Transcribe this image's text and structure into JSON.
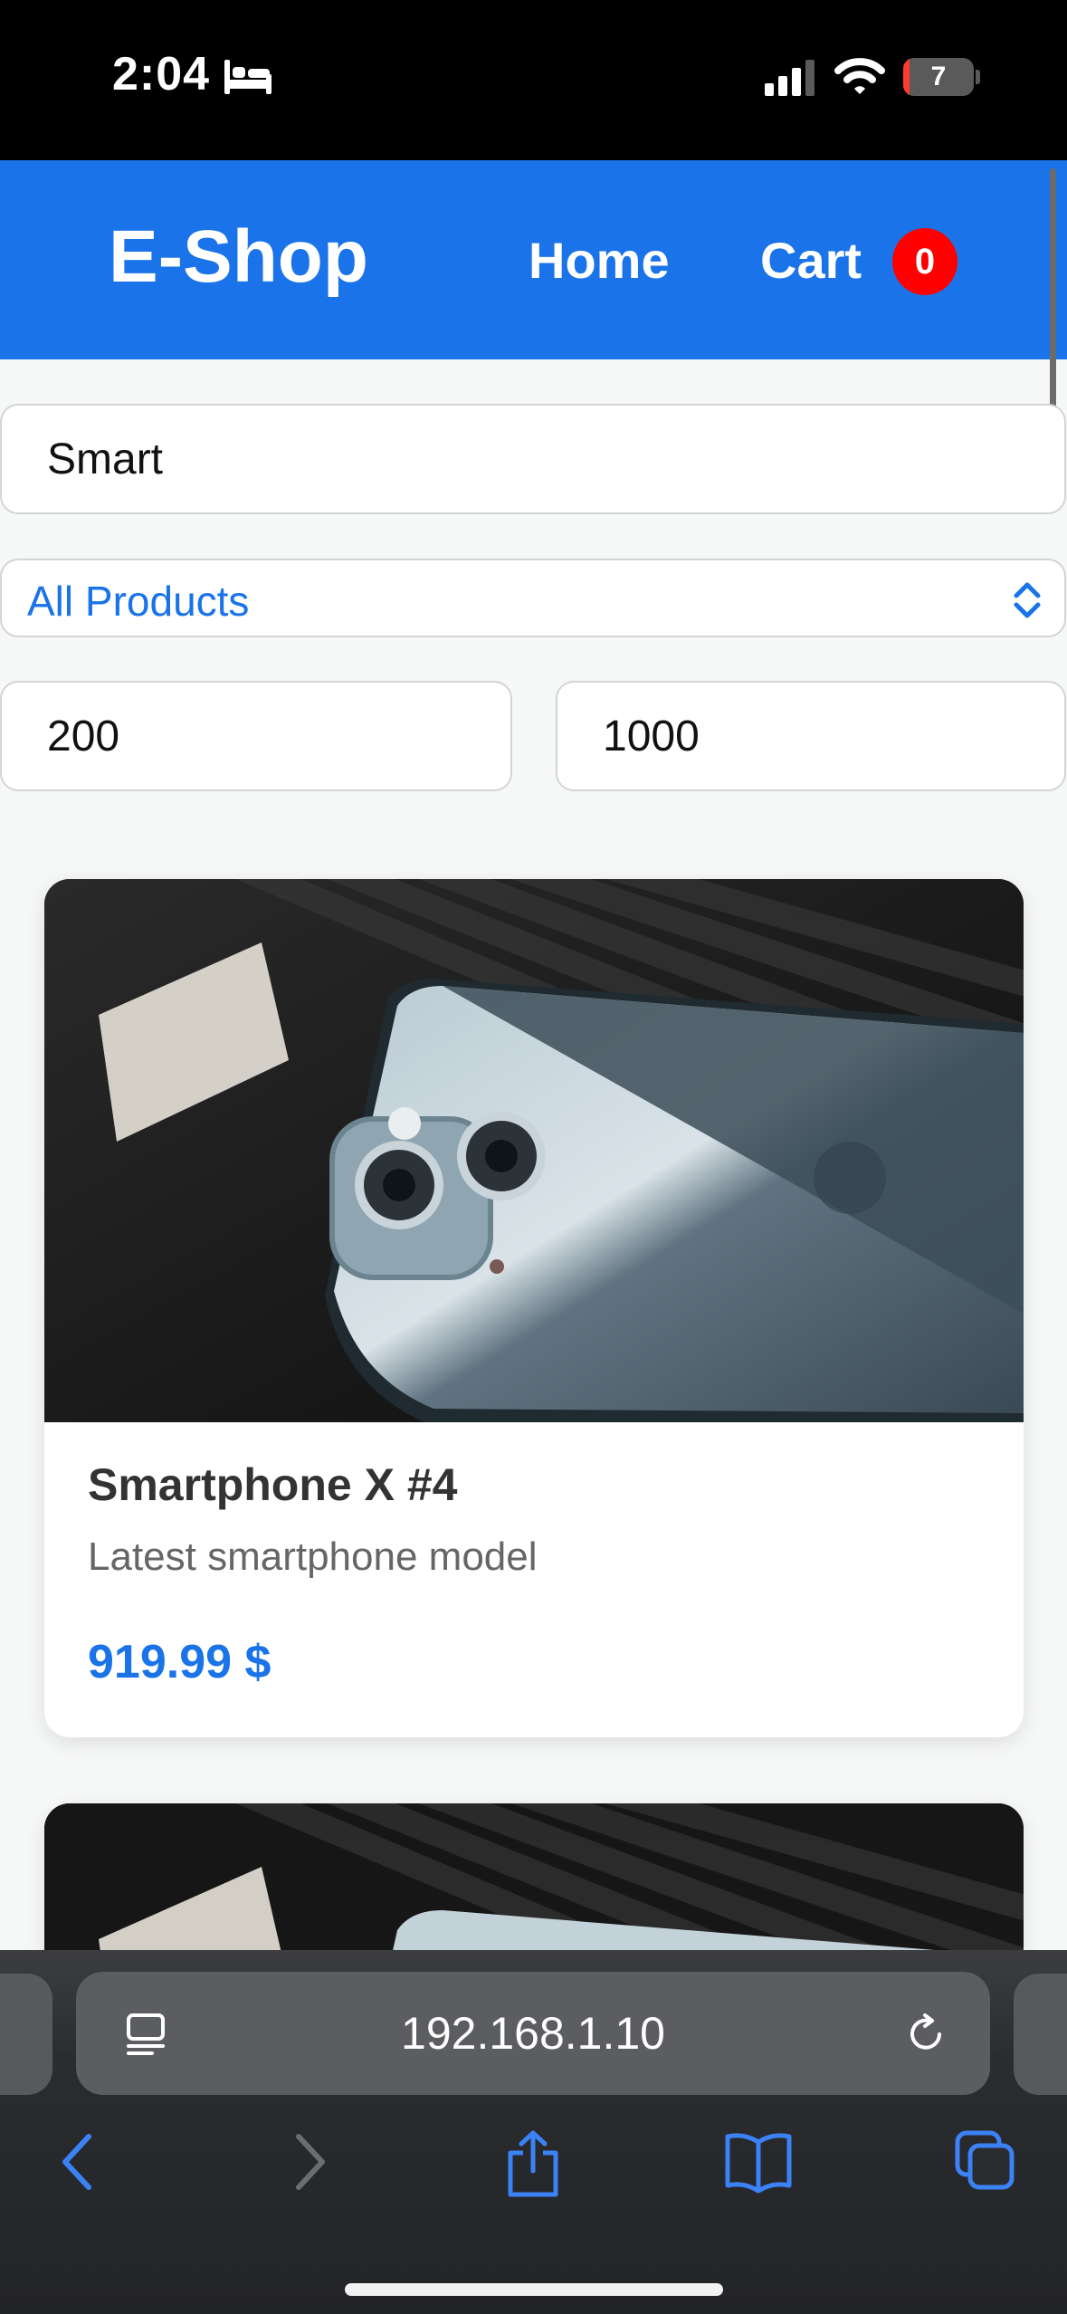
{
  "status_bar": {
    "time": "2:04",
    "battery": "7",
    "icons": [
      "bed-icon",
      "cellular-signal-icon",
      "wifi-icon",
      "battery-icon"
    ]
  },
  "header": {
    "logo": "E-Shop",
    "nav": {
      "home": "Home",
      "cart": "Cart"
    },
    "cart_count": "0"
  },
  "filters": {
    "search_value": "Smart",
    "category_selected": "All Products",
    "min_price": "200",
    "max_price": "1000"
  },
  "products": [
    {
      "title": "Smartphone X #4",
      "description": "Latest smartphone model",
      "price": "919.99 $"
    }
  ],
  "browser": {
    "url": "192.168.1.10",
    "icons": [
      "reader-icon",
      "reload-icon",
      "back-icon",
      "forward-icon",
      "share-icon",
      "bookmarks-icon",
      "tabs-icon"
    ]
  },
  "colors": {
    "header_bg": "#1a73e8",
    "badge_bg": "#ff0000",
    "price": "#1a73e8",
    "page_bg": "#f6f7f7"
  }
}
